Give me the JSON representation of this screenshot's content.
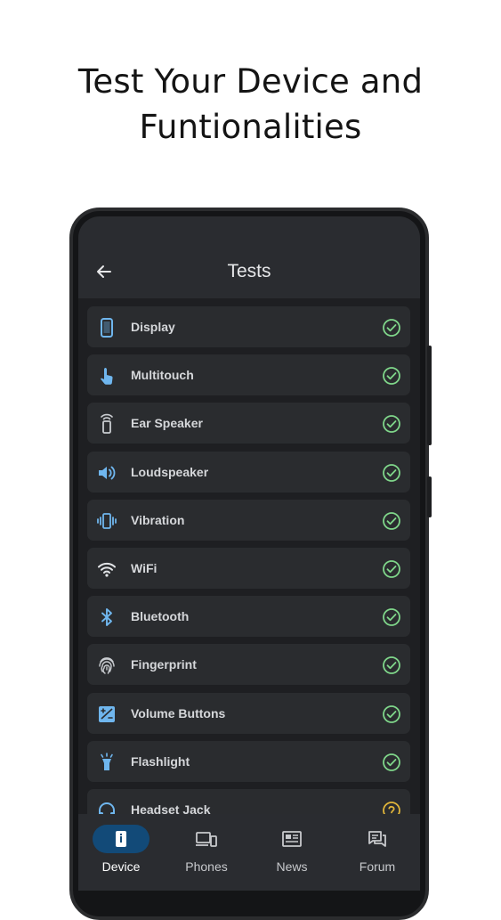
{
  "headline": {
    "line1": "Test Your Device and",
    "line2": "Funtionalities"
  },
  "appbar": {
    "title": "Tests"
  },
  "tests": [
    {
      "label": "Display",
      "icon": "phone-icon",
      "status": "passed"
    },
    {
      "label": "Multitouch",
      "icon": "touch-icon",
      "status": "passed"
    },
    {
      "label": "Ear Speaker",
      "icon": "ear-speaker-icon",
      "status": "passed"
    },
    {
      "label": "Loudspeaker",
      "icon": "speaker-icon",
      "status": "passed"
    },
    {
      "label": "Vibration",
      "icon": "vibration-icon",
      "status": "passed"
    },
    {
      "label": "WiFi",
      "icon": "wifi-icon",
      "status": "passed"
    },
    {
      "label": "Bluetooth",
      "icon": "bluetooth-icon",
      "status": "passed"
    },
    {
      "label": "Fingerprint",
      "icon": "fingerprint-icon",
      "status": "passed"
    },
    {
      "label": "Volume Buttons",
      "icon": "volume-buttons-icon",
      "status": "passed"
    },
    {
      "label": "Flashlight",
      "icon": "flashlight-icon",
      "status": "passed"
    },
    {
      "label": "Headset Jack",
      "icon": "headset-icon",
      "status": "unknown"
    }
  ],
  "nav": {
    "tabs": [
      {
        "label": "Device",
        "icon": "device-info-icon",
        "active": true
      },
      {
        "label": "Phones",
        "icon": "phones-icon",
        "active": false
      },
      {
        "label": "News",
        "icon": "news-icon",
        "active": false
      },
      {
        "label": "Forum",
        "icon": "forum-icon",
        "active": false
      }
    ]
  },
  "colors": {
    "accent": "#6fb6ee",
    "passed": "#7fd68a",
    "unknown": "#e0b53a",
    "active_tab": "#124a78"
  }
}
